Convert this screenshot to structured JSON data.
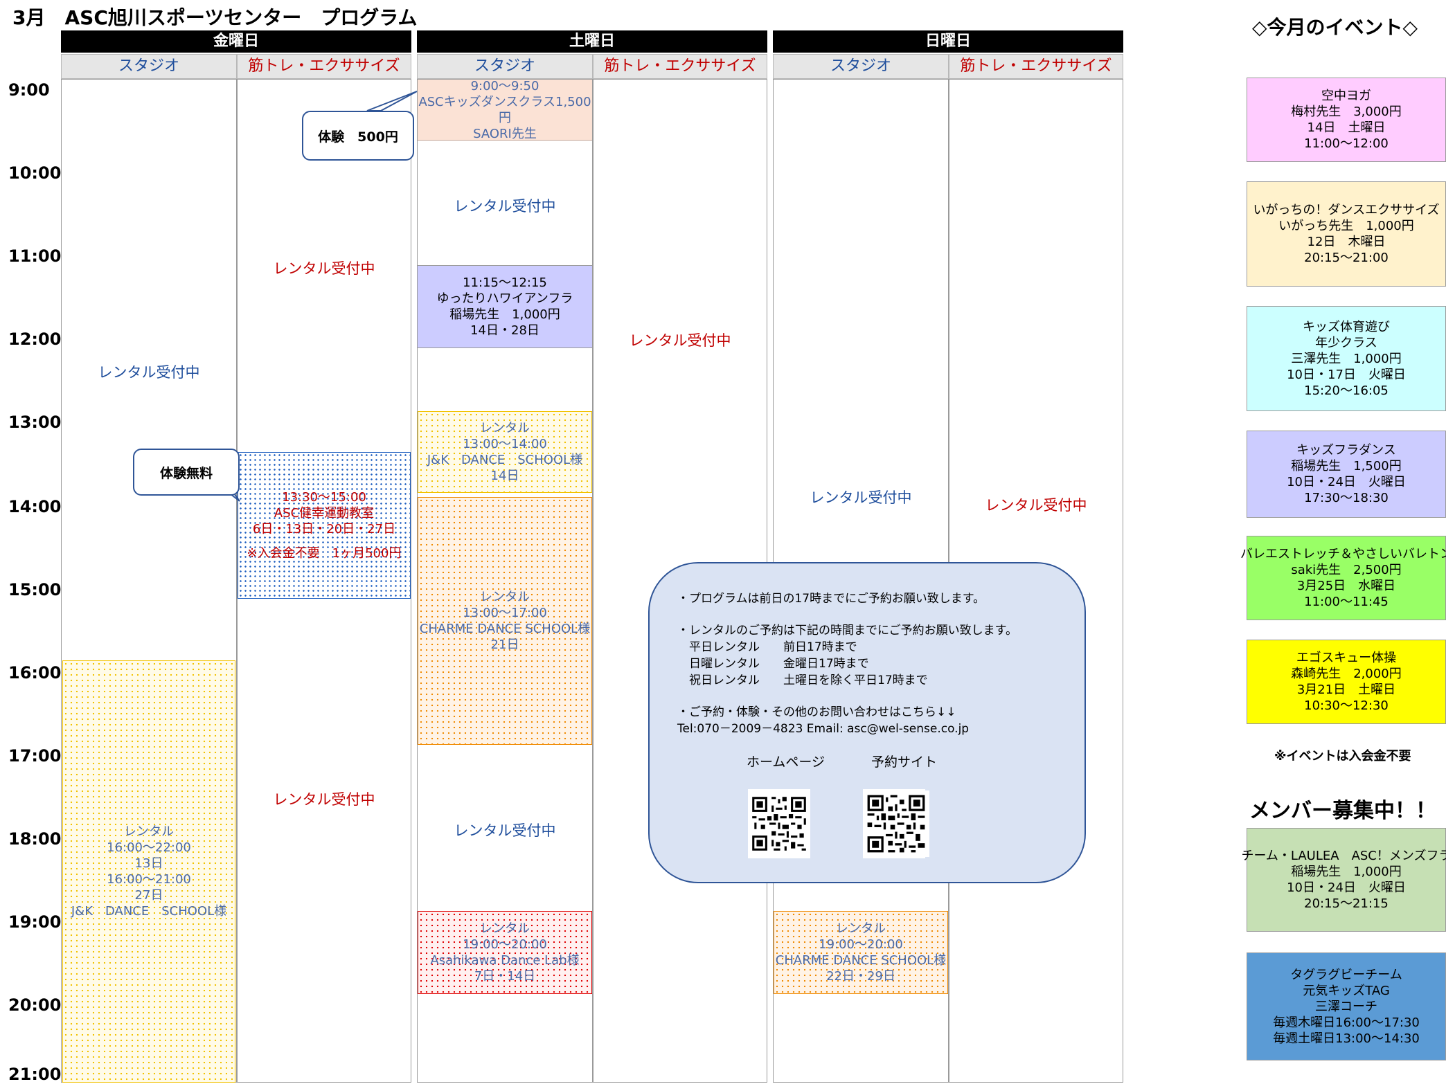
{
  "title": "3月　ASC旭川スポーツセンター　プログラム",
  "days": [
    {
      "name": "金曜日",
      "studio": "スタジオ",
      "training": "筋トレ・エクササイズ"
    },
    {
      "name": "土曜日",
      "studio": "スタジオ",
      "training": "筋トレ・エクササイズ"
    },
    {
      "name": "日曜日",
      "studio": "スタジオ",
      "training": "筋トレ・エクササイズ"
    }
  ],
  "times": [
    "9:00",
    "10:00",
    "11:00",
    "12:00",
    "13:00",
    "14:00",
    "15:00",
    "16:00",
    "17:00",
    "18:00",
    "19:00",
    "20:00",
    "21:00"
  ],
  "rental_open": "レンタル受付中",
  "fri": {
    "studio_rental": {
      "lines": [
        "レンタル",
        "16:00～22:00",
        "13日",
        "16:00～21:00",
        "27日",
        "J&K　DANCE　SCHOOL様"
      ]
    },
    "training_class": {
      "lines": [
        "13:30～15:00",
        "ASC健幸運動教室",
        "6日・13日・20日・27日",
        "",
        "※入会金不要　1ヶ月500円"
      ]
    }
  },
  "sat": {
    "kids_dance": {
      "lines": [
        "9:00～9:50",
        "ASCキッズダンスクラス1,500",
        "円",
        "SAORI先生"
      ]
    },
    "hula": {
      "lines": [
        "11:15～12:15",
        "ゆったりハワイアンフラ",
        "稲場先生　1,000円",
        "14日・28日"
      ]
    },
    "jk": {
      "lines": [
        "レンタル",
        "13:00～14:00",
        "J&K　DANCE　SCHOOL様",
        "14日"
      ]
    },
    "charme": {
      "lines": [
        "レンタル",
        "13:00～17:00",
        "CHARME DANCE SCHOOL様",
        "21日"
      ]
    },
    "asahikawa": {
      "lines": [
        "レンタル",
        "19:00～20:00",
        "Asahikawa Dance Lab様",
        "7日・14日"
      ]
    }
  },
  "sun": {
    "charme": {
      "lines": [
        "レンタル",
        "19:00～20:00",
        "CHARME DANCE SCHOOL様",
        "22日・29日"
      ]
    }
  },
  "callouts": {
    "trial_500": "体験　500円",
    "trial_free": "体験無料"
  },
  "info": {
    "line1": "・プログラムは前日の17時までにご予約お願い致します。",
    "line2": "・レンタルのご予約は下記の時間までにご予約お願い致します。",
    "line3": "　平日レンタル　　前日17時まで",
    "line4": "　日曜レンタル　　金曜日17時まで",
    "line5": "　祝日レンタル　　土曜日を除く平日17時まで",
    "line6": "・ご予約・体験・その他のお問い合わせはこちら↓↓",
    "line7": "Tel:070－2009－4823 Email: asc@wel-sense.co.jp",
    "homepage": "ホームページ",
    "reserve": "予約サイト"
  },
  "events_title": "◇今月のイベント◇",
  "events": [
    {
      "lines": [
        "空中ヨガ",
        "梅村先生　3,000円",
        "14日　土曜日",
        "11:00～12:00"
      ],
      "color": "#ffccff"
    },
    {
      "lines": [
        "いがっちの！ダンスエクササイズ",
        "いがっち先生　1,000円",
        "12日　木曜日",
        "20:15～21:00"
      ],
      "color": "#fff2cc"
    },
    {
      "lines": [
        "キッズ体育遊び",
        "年少クラス",
        "三澤先生　1,000円",
        "10日・17日　火曜日",
        "15:20～16:05"
      ],
      "color": "#ccffff"
    },
    {
      "lines": [
        "キッズフラダンス",
        "稲場先生　1,500円",
        "10日・24日　火曜日",
        "17:30～18:30"
      ],
      "color": "#ccccff"
    },
    {
      "lines": [
        "バレエストレッチ＆やさしいバレトン",
        "saki先生　2,500円",
        "3月25日　水曜日",
        "11:00～11:45"
      ],
      "color": "#99ff66"
    },
    {
      "lines": [
        "エゴスキュー体操",
        "森崎先生　2,000円",
        "3月21日　土曜日",
        "10:30～12:30"
      ],
      "color": "#ffff00"
    }
  ],
  "event_note": "※イベントは入会金不要",
  "members_title": "メンバー募集中！！",
  "members": [
    {
      "lines": [
        "チーム・LAULEA　ASC！メンズフラ",
        "稲場先生　1,000円",
        "10日・24日　火曜日",
        "20:15～21:15"
      ],
      "color": "#c6e0b4"
    },
    {
      "lines": [
        "タグラグビーチーム",
        "元気キッズTAG",
        "三澤コーチ",
        "毎週木曜日16:00～17:30",
        "毎週土曜日13:00～14:30"
      ],
      "color": "#5b9bd5"
    }
  ]
}
